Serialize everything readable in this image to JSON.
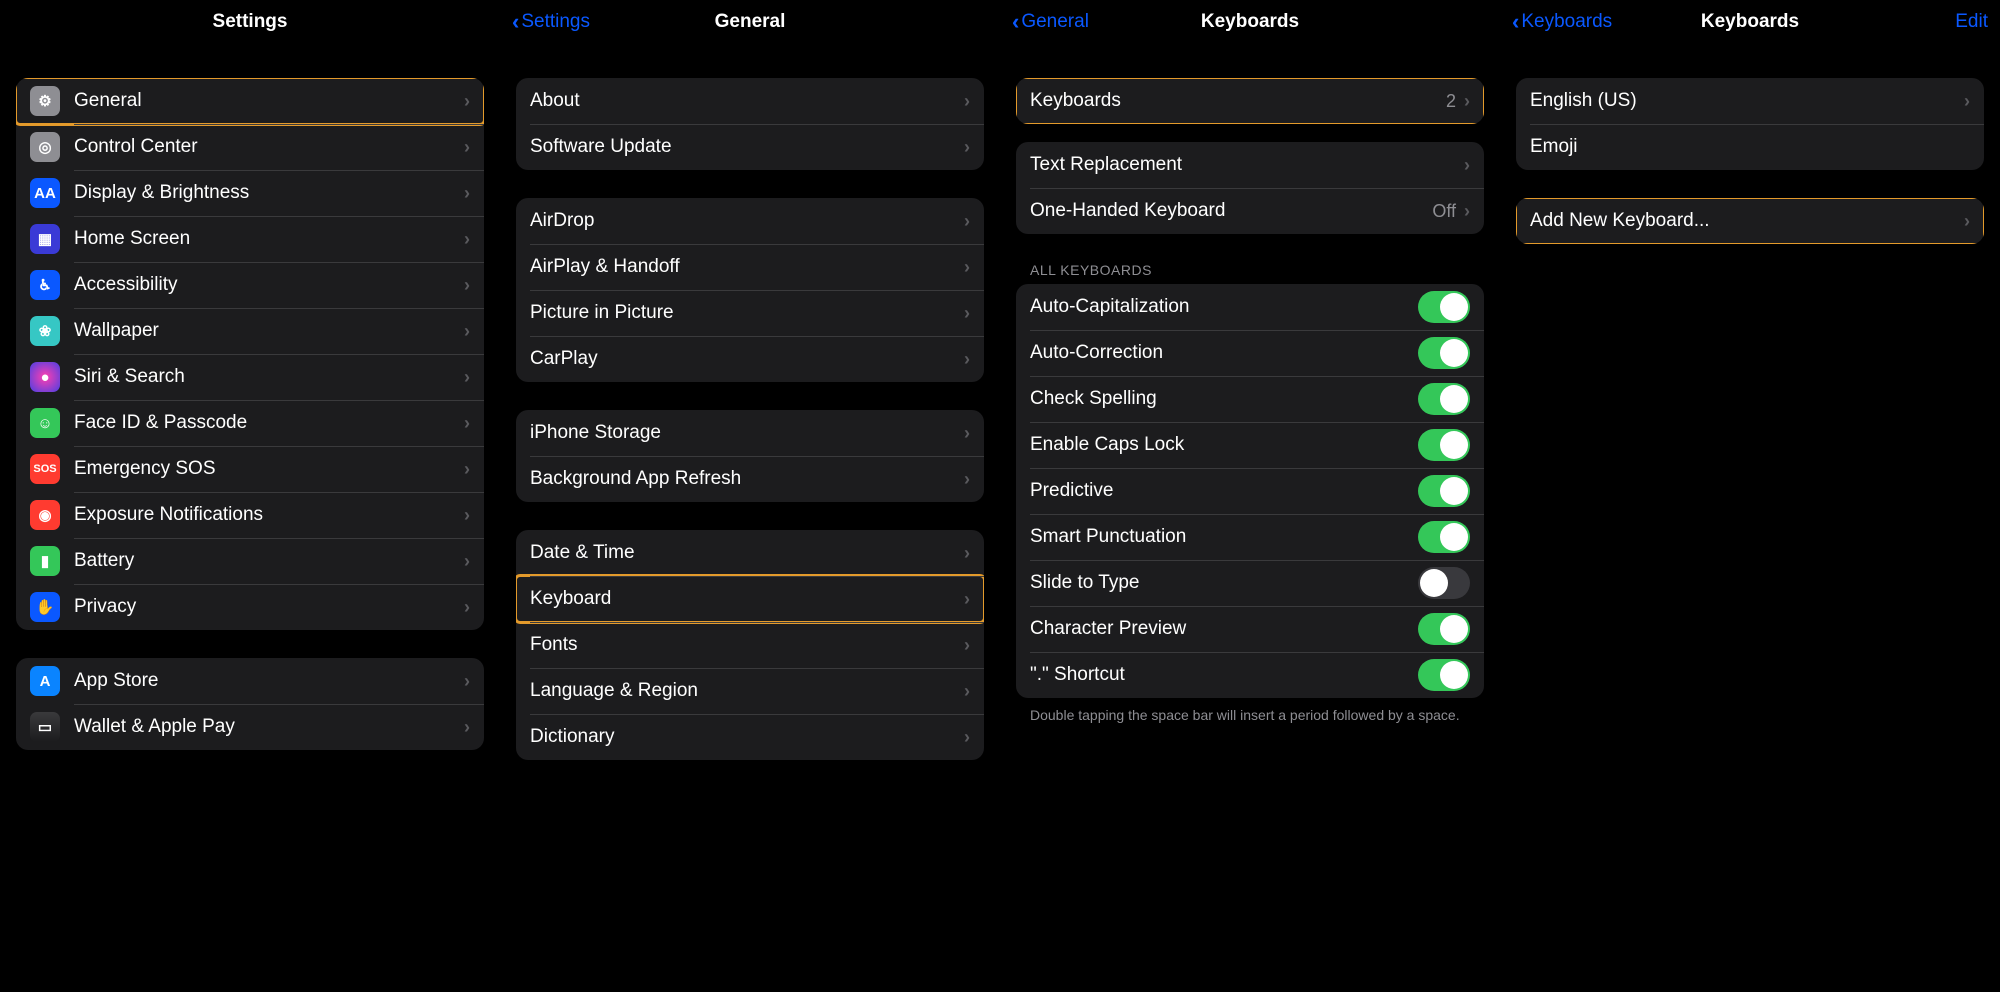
{
  "panel1": {
    "title": "Settings",
    "group1": [
      {
        "label": "General",
        "iconClass": "i-gear",
        "iconGlyph": "⚙",
        "highlight": true
      },
      {
        "label": "Control Center",
        "iconClass": "i-cc",
        "iconGlyph": "◎"
      },
      {
        "label": "Display & Brightness",
        "iconClass": "i-disp",
        "iconGlyph": "AA"
      },
      {
        "label": "Home Screen",
        "iconClass": "i-home",
        "iconGlyph": "▦"
      },
      {
        "label": "Accessibility",
        "iconClass": "i-acc",
        "iconGlyph": "♿︎"
      },
      {
        "label": "Wallpaper",
        "iconClass": "i-wall",
        "iconGlyph": "❀"
      },
      {
        "label": "Siri & Search",
        "iconClass": "i-siri",
        "iconGlyph": "●"
      },
      {
        "label": "Face ID & Passcode",
        "iconClass": "i-face",
        "iconGlyph": "☺"
      },
      {
        "label": "Emergency SOS",
        "iconClass": "i-sos",
        "iconGlyph": "SOS"
      },
      {
        "label": "Exposure Notifications",
        "iconClass": "i-exp",
        "iconGlyph": "◉"
      },
      {
        "label": "Battery",
        "iconClass": "i-bat",
        "iconGlyph": "▮"
      },
      {
        "label": "Privacy",
        "iconClass": "i-priv",
        "iconGlyph": "✋"
      }
    ],
    "group2": [
      {
        "label": "App Store",
        "iconClass": "i-app",
        "iconGlyph": "A"
      },
      {
        "label": "Wallet & Apple Pay",
        "iconClass": "i-wal",
        "iconGlyph": "▭"
      }
    ]
  },
  "panel2": {
    "back": "Settings",
    "title": "General",
    "groups": [
      [
        {
          "label": "About"
        },
        {
          "label": "Software Update"
        }
      ],
      [
        {
          "label": "AirDrop"
        },
        {
          "label": "AirPlay & Handoff"
        },
        {
          "label": "Picture in Picture"
        },
        {
          "label": "CarPlay"
        }
      ],
      [
        {
          "label": "iPhone Storage"
        },
        {
          "label": "Background App Refresh"
        }
      ],
      [
        {
          "label": "Date & Time"
        },
        {
          "label": "Keyboard",
          "highlight": true
        },
        {
          "label": "Fonts"
        },
        {
          "label": "Language & Region"
        },
        {
          "label": "Dictionary"
        }
      ]
    ]
  },
  "panel3": {
    "back": "General",
    "title": "Keyboards",
    "group1": [
      {
        "label": "Keyboards",
        "value": "2",
        "highlight": true
      }
    ],
    "group2": [
      {
        "label": "Text Replacement"
      },
      {
        "label": "One-Handed Keyboard",
        "value": "Off"
      }
    ],
    "sectionHeader": "ALL KEYBOARDS",
    "group3": [
      {
        "label": "Auto-Capitalization",
        "on": true
      },
      {
        "label": "Auto-Correction",
        "on": true
      },
      {
        "label": "Check Spelling",
        "on": true
      },
      {
        "label": "Enable Caps Lock",
        "on": true
      },
      {
        "label": "Predictive",
        "on": true
      },
      {
        "label": "Smart Punctuation",
        "on": true
      },
      {
        "label": "Slide to Type",
        "on": false
      },
      {
        "label": "Character Preview",
        "on": true
      },
      {
        "label": "\".\" Shortcut",
        "on": true
      }
    ],
    "footer": "Double tapping the space bar will insert a period followed by a space."
  },
  "panel4": {
    "back": "Keyboards",
    "title": "Keyboards",
    "edit": "Edit",
    "group1": [
      {
        "label": "English (US)",
        "chevron": true
      },
      {
        "label": "Emoji",
        "chevron": false
      }
    ],
    "group2": [
      {
        "label": "Add New Keyboard...",
        "highlight": true
      }
    ]
  }
}
